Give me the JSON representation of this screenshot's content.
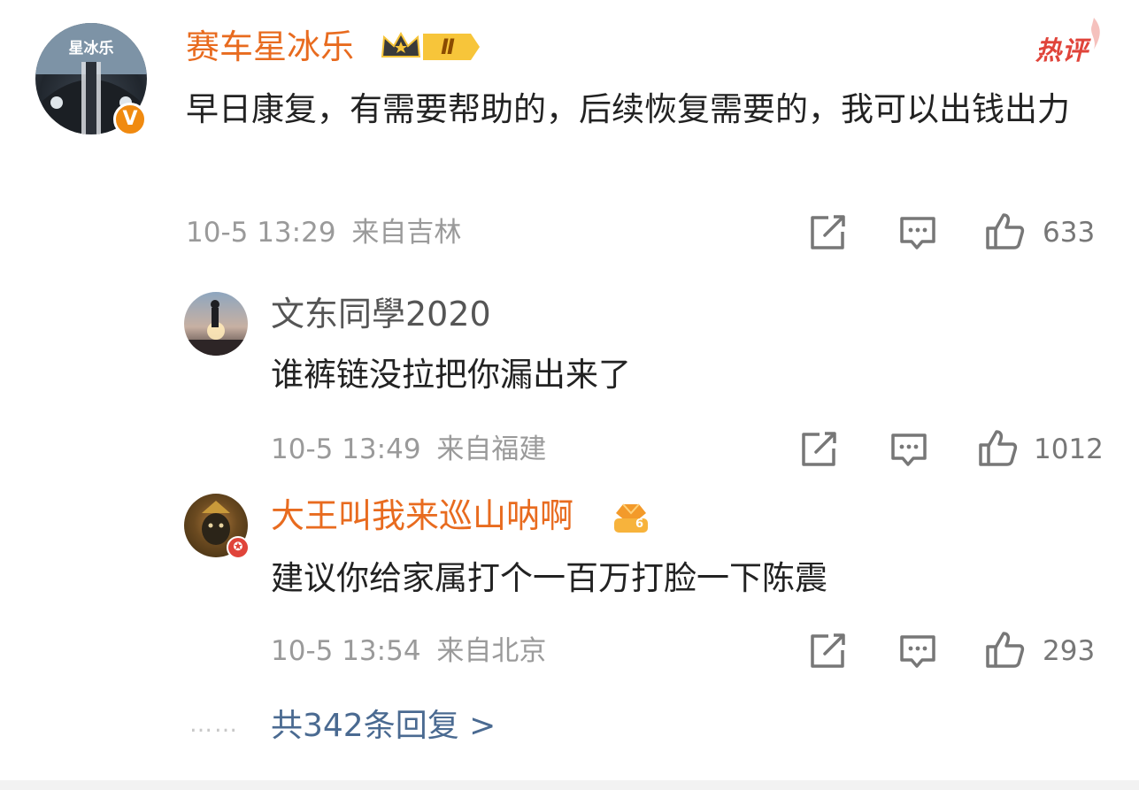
{
  "badges": {
    "hot": "热评",
    "crown_level": "Ⅱ",
    "avatar_text": "星冰乐",
    "diamond_level": "6"
  },
  "main_comment": {
    "username": "赛车星冰乐",
    "text": "早日康复，有需要帮助的，后续恢复需要的，我可以出钱出力",
    "time": "10-5 13:29",
    "location": "来自吉林",
    "likes": "633"
  },
  "replies": [
    {
      "username": "文东同學2020",
      "text": "谁裤链没拉把你漏出来了",
      "time": "10-5 13:49",
      "location": "来自福建",
      "likes": "1012"
    },
    {
      "username": "大王叫我来巡山呐啊",
      "text": "建议你给家属打个一百万打脸一下陈震",
      "time": "10-5 13:54",
      "location": "来自北京",
      "likes": "293"
    }
  ],
  "more_replies": {
    "dots": "……",
    "label": "共342条回复 >"
  },
  "colors": {
    "accent_orange": "#e86b1f",
    "link_blue": "#4a6a91",
    "hot_red": "#e0443a",
    "verify_orange": "#f08a10"
  },
  "icons": [
    "repost-icon",
    "comment-icon",
    "like-icon"
  ]
}
